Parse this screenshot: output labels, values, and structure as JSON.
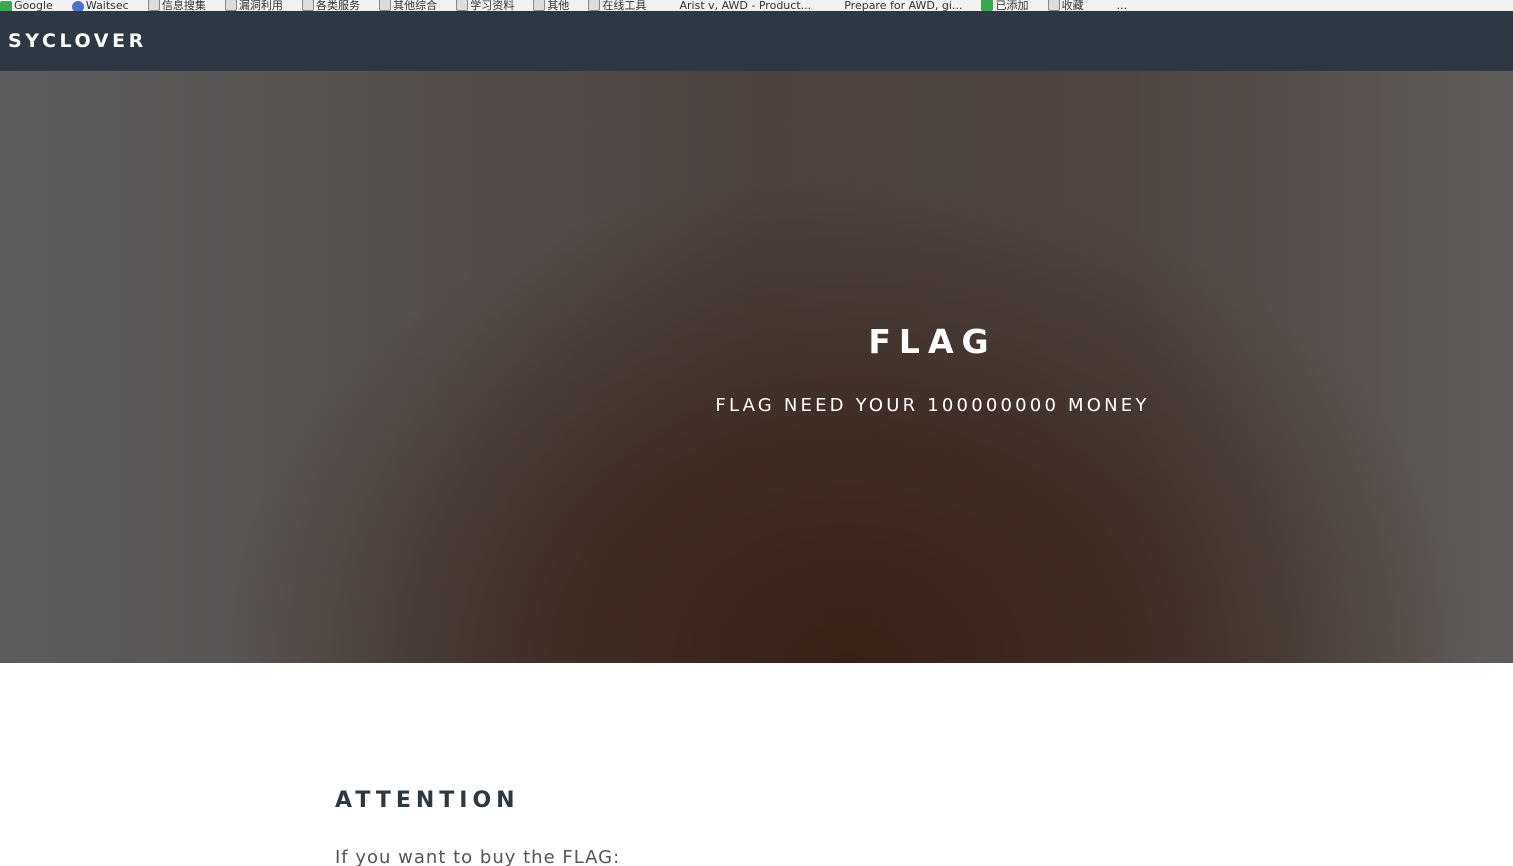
{
  "bookmarks": [
    {
      "label": "Google",
      "icon": "google-icon"
    },
    {
      "label": "Waitsec",
      "icon": "bookmark-icon"
    },
    {
      "label": "信息搜集",
      "icon": "folder-icon"
    },
    {
      "label": "漏洞利用",
      "icon": "folder-icon"
    },
    {
      "label": "各类服务",
      "icon": "folder-icon"
    },
    {
      "label": "其他综合",
      "icon": "folder-icon"
    },
    {
      "label": "学习资料",
      "icon": "folder-icon"
    },
    {
      "label": "其他",
      "icon": "folder-icon"
    },
    {
      "label": "在线工具",
      "icon": "folder-icon"
    },
    {
      "label": "Arist v, AWD - Product...",
      "icon": "code-icon"
    },
    {
      "label": "Prepare for AWD, gi...",
      "icon": "code-icon"
    },
    {
      "label": "已添加",
      "icon": "green-icon"
    },
    {
      "label": "收藏",
      "icon": "folder-icon"
    },
    {
      "label": "...",
      "icon": "code-icon"
    }
  ],
  "navbar": {
    "brand": "SYCLOVER"
  },
  "hero": {
    "title": "FLAG",
    "subtitle": "FLAG NEED YOUR 100000000 MONEY"
  },
  "content": {
    "section_title": "ATTENTION",
    "section_text": "If you want to buy the FLAG:"
  },
  "colors": {
    "navbar_bg": "#2d3843",
    "hero_text": "#ffffff",
    "section_title": "#2d3843",
    "body_text": "#555555"
  }
}
